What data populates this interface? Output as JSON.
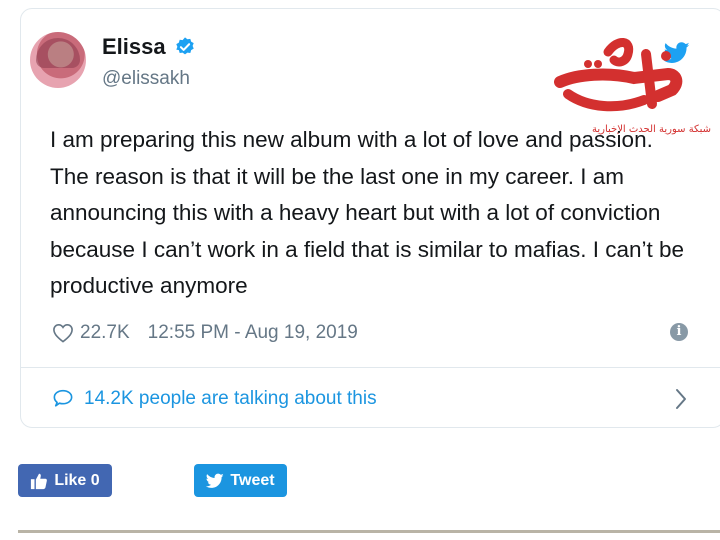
{
  "tweet": {
    "author_name": "Elissa",
    "author_handle": "@elissakh",
    "text": "I am preparing this new album with a lot of love and passion. The reason is that it will be the last one in my career. I am announcing this with a heavy heart but with a lot of conviction because I can’t work in a field that is similar to mafias. I can’t be productive anymore",
    "likes": "22.7K",
    "timestamp": "12:55 PM - Aug 19, 2019",
    "talking_label": "14.2K people are talking about this"
  },
  "watermark": {
    "logo_text": "الحدث",
    "subtitle": "شبكة سورية الحدث الإخبارية"
  },
  "share": {
    "like_label": "Like 0",
    "tweet_label": "Tweet"
  },
  "colors": {
    "twitter_blue": "#1da1f2",
    "link_blue": "#1b95e0",
    "facebook_blue": "#4267b2",
    "watermark_red": "#d3302f",
    "secondary_text": "#657786"
  },
  "icons": [
    "avatar",
    "verified-badge-icon",
    "twitter-bird-icon",
    "heart-icon",
    "info-icon",
    "chat-bubble-icon",
    "chevron-right-icon",
    "thumbs-up-icon",
    "twitter-bird-icon"
  ]
}
